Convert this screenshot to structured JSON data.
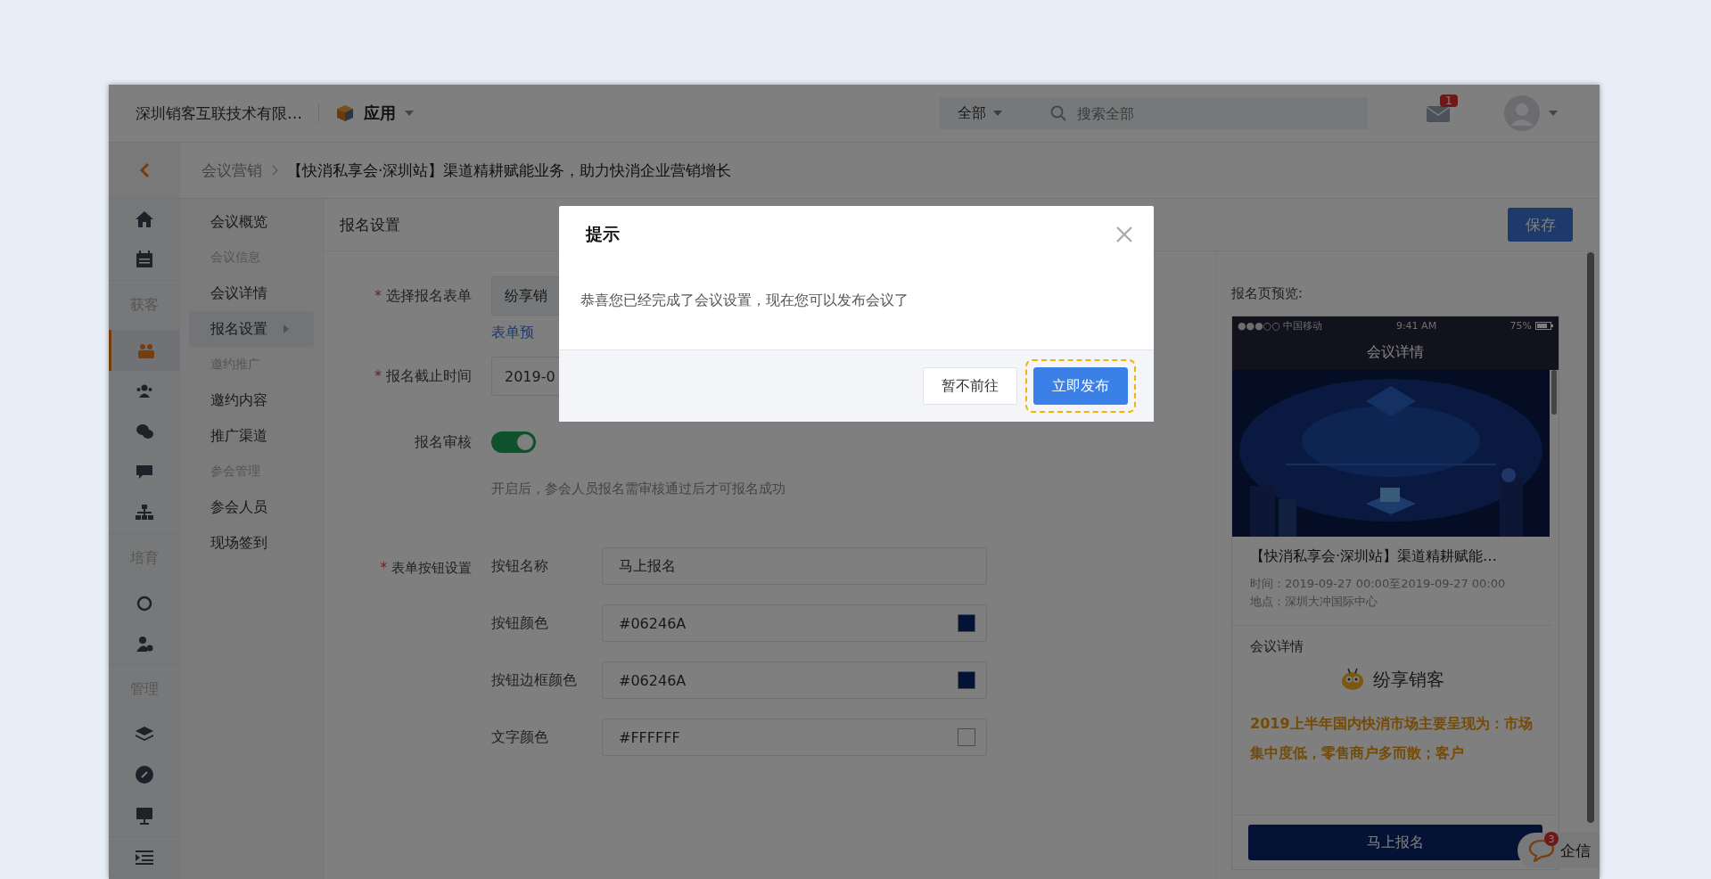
{
  "topbar": {
    "company": "深圳销客互联技术有限…",
    "app_menu": "应用",
    "scope": "全部",
    "search_placeholder": "搜索全部",
    "mail_badge": "1"
  },
  "breadcrumb": [
    "会议营销",
    "【快消私享会·深圳站】渠道精耕赋能业务，助力快消企业营销增长"
  ],
  "rail": [
    {
      "kind": "item",
      "selected": false
    },
    {
      "kind": "item",
      "selected": false
    },
    {
      "kind": "heading",
      "label": "获客"
    },
    {
      "kind": "item",
      "selected": true
    },
    {
      "kind": "item",
      "selected": false
    },
    {
      "kind": "item",
      "selected": false
    },
    {
      "kind": "item",
      "selected": false
    },
    {
      "kind": "item",
      "selected": false
    },
    {
      "kind": "heading",
      "label": "培育"
    },
    {
      "kind": "item",
      "selected": false
    },
    {
      "kind": "item",
      "selected": false
    },
    {
      "kind": "heading",
      "label": "管理"
    },
    {
      "kind": "item",
      "selected": false
    },
    {
      "kind": "item",
      "selected": false
    },
    {
      "kind": "item",
      "selected": false
    }
  ],
  "submenu": [
    {
      "kind": "item",
      "label": "会议概览",
      "selected": false
    },
    {
      "kind": "group",
      "label": "会议信息"
    },
    {
      "kind": "item",
      "label": "会议详情",
      "selected": false
    },
    {
      "kind": "item",
      "label": "报名设置",
      "selected": true
    },
    {
      "kind": "group",
      "label": "邀约推广"
    },
    {
      "kind": "item",
      "label": "邀约内容",
      "selected": false
    },
    {
      "kind": "item",
      "label": "推广渠道",
      "selected": false
    },
    {
      "kind": "group",
      "label": "参会管理"
    },
    {
      "kind": "item",
      "label": "参会人员",
      "selected": false
    },
    {
      "kind": "item",
      "label": "现场签到",
      "selected": false
    }
  ],
  "content": {
    "title": "报名设置",
    "save": "保存",
    "form": {
      "select_form": {
        "label": "选择报名表单",
        "required_mark": "*",
        "value": "纷享销",
        "link": "表单预"
      },
      "deadline": {
        "label": "报名截止时间",
        "required_mark": "*",
        "value": "2019-0"
      },
      "review": {
        "label": "报名审核",
        "on": true,
        "hint": "开启后，参会人员报名需审核通过后才可报名成功"
      },
      "button_settings": {
        "label": "表单按钮设置",
        "required_mark": "*",
        "fields": [
          {
            "kind": "text",
            "label": "按钮名称",
            "value": "马上报名"
          },
          {
            "kind": "color",
            "label": "按钮颜色",
            "value": "#06246A"
          },
          {
            "kind": "color",
            "label": "按钮边框颜色",
            "value": "#06246A"
          },
          {
            "kind": "color",
            "label": "文字颜色",
            "value": "#FFFFFF"
          }
        ]
      }
    },
    "preview": {
      "label": "报名页预览:",
      "status": {
        "carrier": "●●●○○ 中国移动",
        "time": "9:41 AM",
        "battery": "75%"
      },
      "nav_title": "会议详情",
      "event_title": "【快消私享会·深圳站】渠道精耕赋能…",
      "time": "时间：2019-09-27 00:00至2019-09-27 00:00",
      "place": "地点：深圳大冲国际中心",
      "section": "会议详情",
      "brand": "纷享销客",
      "intro": "2019上半年国内快消市场主要呈现为：市场集中度低，零售商户多而散；客户",
      "cta": "马上报名"
    }
  },
  "chat": {
    "label": "企信",
    "badge": "3"
  },
  "dialog": {
    "title": "提示",
    "message": "恭喜您已经完成了会议设置，现在您可以发布会议了",
    "buttons": [
      {
        "kind": "secondary",
        "label": "暂不前往",
        "highlighted": false
      },
      {
        "kind": "primary",
        "label": "立即发布",
        "highlighted": true
      }
    ]
  }
}
